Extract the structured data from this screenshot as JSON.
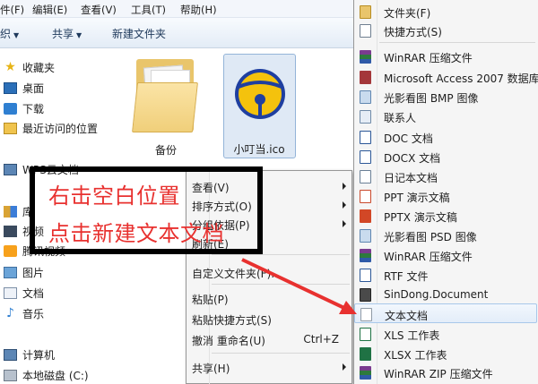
{
  "menubar": {
    "items": [
      "件(F)",
      "编辑(E)",
      "查看(V)",
      "工具(T)",
      "帮助(H)"
    ]
  },
  "toolbar": {
    "organize": "织",
    "share": "共享",
    "new_folder": "新建文件夹"
  },
  "nav": {
    "favorites": "收藏夹",
    "desktop": "桌面",
    "downloads": "下载",
    "recent": "最近访问的位置",
    "wps": "WPS云文档",
    "libraries": "库",
    "videos": "视频",
    "tencent_video": "腾讯视频",
    "pictures": "图片",
    "documents": "文档",
    "music": "音乐",
    "computer": "计算机",
    "local_disk": "本地磁盘 (C:)"
  },
  "files": {
    "folder_name": "备份",
    "ico_name": "小叮当.ico"
  },
  "context_menu": {
    "view": "查看(V)",
    "sort": "排序方式(O)",
    "group": "分组依据(P)",
    "refresh": "刷新(E)",
    "customize": "自定义文件夹(F)...",
    "paste": "粘贴(P)",
    "paste_shortcut": "粘贴快捷方式(S)",
    "undo_rename": "撤消 重命名(U)",
    "undo_shortcut": "Ctrl+Z",
    "share": "共享(H)"
  },
  "submenu": {
    "items": [
      {
        "label": "文件夹(F)",
        "icon": "folder-icon",
        "color": "#e9c56b"
      },
      {
        "label": "快捷方式(S)",
        "icon": "shortcut-icon",
        "color": "#ffffff"
      },
      {
        "label": "WinRAR 压缩文件",
        "icon": "winrar-icon",
        "color": "#7a3b8f"
      },
      {
        "label": "Microsoft Access 2007 数据库",
        "icon": "access-icon",
        "color": "#a4373a"
      },
      {
        "label": "光影看图 BMP 图像",
        "icon": "bmp-icon",
        "color": "#c9dbee"
      },
      {
        "label": "联系人",
        "icon": "contact-icon",
        "color": "#e6edf6"
      },
      {
        "label": "DOC 文档",
        "icon": "doc-icon",
        "color": "#2b5797"
      },
      {
        "label": "DOCX 文档",
        "icon": "docx-icon",
        "color": "#2b5797"
      },
      {
        "label": "日记本文档",
        "icon": "journal-icon",
        "color": "#6a7f96"
      },
      {
        "label": "PPT 演示文稿",
        "icon": "ppt-icon",
        "color": "#c9492b"
      },
      {
        "label": "PPTX 演示文稿",
        "icon": "pptx-icon",
        "color": "#d24726"
      },
      {
        "label": "光影看图 PSD 图像",
        "icon": "psd-icon",
        "color": "#c9dbee"
      },
      {
        "label": "WinRAR 压缩文件",
        "icon": "winrar-icon",
        "color": "#7a3b8f"
      },
      {
        "label": "RTF 文件",
        "icon": "rtf-icon",
        "color": "#2b5797"
      },
      {
        "label": "SinDong.Document",
        "icon": "sindong-icon",
        "color": "#4a4a4a"
      },
      {
        "label": "文本文档",
        "icon": "text-document-icon",
        "color": "#ffffff"
      },
      {
        "label": "XLS 工作表",
        "icon": "xls-icon",
        "color": "#1f7244"
      },
      {
        "label": "XLSX 工作表",
        "icon": "xlsx-icon",
        "color": "#1f7244"
      },
      {
        "label": "WinRAR ZIP 压缩文件",
        "icon": "winrar-zip-icon",
        "color": "#7a3b8f"
      }
    ]
  },
  "annotation": {
    "line1": "右击空白位置",
    "line2": "点击新建文本文档",
    "color": "#e8312f"
  }
}
